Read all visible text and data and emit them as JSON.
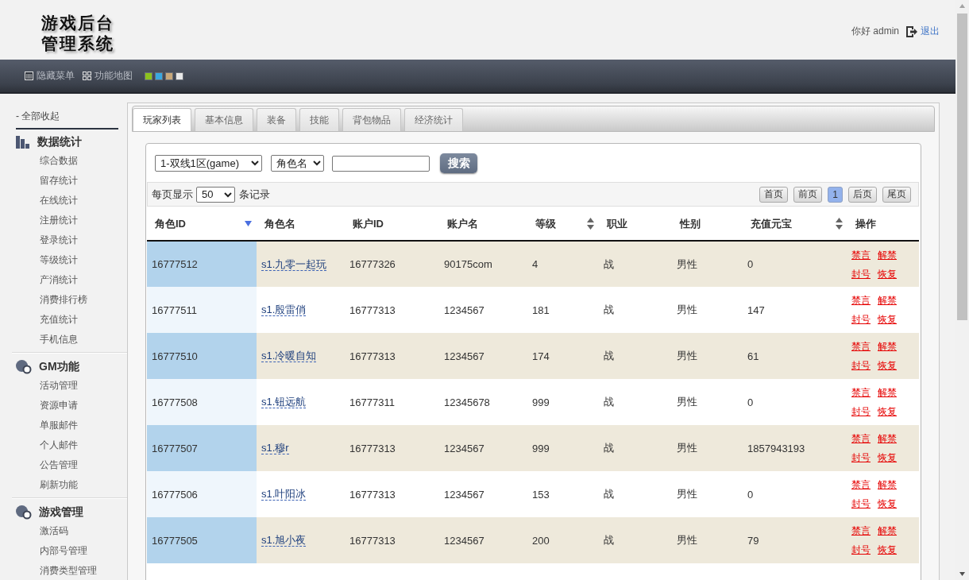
{
  "header": {
    "logo_lines": [
      "游戏后台",
      "管理系统"
    ],
    "greeting": "你好 admin",
    "logout": "退出"
  },
  "nav": {
    "items": [
      {
        "label": "隐藏菜单"
      },
      {
        "label": "功能地图"
      }
    ],
    "themes": [
      {
        "color": "#8cc21e"
      },
      {
        "color": "#3aa8e0"
      },
      {
        "color": "#c8a87a"
      },
      {
        "color": "#e8e8e8"
      }
    ]
  },
  "sidebar": {
    "collapse_all": "- 全部收起",
    "groups": [
      {
        "title": "数据统计",
        "items": [
          "综合数据",
          "留存统计",
          "在线统计",
          "注册统计",
          "登录统计",
          "等级统计",
          "产消统计",
          "消费排行榜",
          "充值统计",
          "手机信息"
        ]
      },
      {
        "title": "GM功能",
        "items": [
          "活动管理",
          "资源申请",
          "单服邮件",
          "个人邮件",
          "公告管理",
          "刷新功能"
        ]
      },
      {
        "title": "游戏管理",
        "items": [
          "激活码",
          "内部号管理",
          "消费类型管理"
        ]
      }
    ]
  },
  "tabs": [
    {
      "label": "玩家列表",
      "selected": true
    },
    {
      "label": "基本信息",
      "selected": false
    },
    {
      "label": "装备",
      "selected": false
    },
    {
      "label": "技能",
      "selected": false
    },
    {
      "label": "背包物品",
      "selected": false
    },
    {
      "label": "经济统计",
      "selected": false
    }
  ],
  "search": {
    "server": "1-双线1区(game)",
    "field": "角色名",
    "button": "搜索"
  },
  "pager": {
    "label_before": "每页显示",
    "page_size": "50",
    "label_after": "条记录",
    "buttons": [
      {
        "label": "首页",
        "selected": false
      },
      {
        "label": "前页",
        "selected": false
      },
      {
        "label": "1",
        "selected": true
      },
      {
        "label": "后页",
        "selected": false
      },
      {
        "label": "尾页",
        "selected": false
      }
    ]
  },
  "table": {
    "columns": [
      {
        "label": "角色ID",
        "kind": "text",
        "sorted": true
      },
      {
        "label": "角色名",
        "kind": "link"
      },
      {
        "label": "账户ID",
        "kind": "text"
      },
      {
        "label": "账户名",
        "kind": "text"
      },
      {
        "label": "等级",
        "kind": "text",
        "sortable": true
      },
      {
        "label": "职业",
        "kind": "text"
      },
      {
        "label": "性别",
        "kind": "text"
      },
      {
        "label": "充值元宝",
        "kind": "text",
        "sortable": true
      },
      {
        "label": "操作",
        "kind": "actions"
      }
    ],
    "rows": [
      {
        "cells": [
          "16777512",
          "s1.九零一起玩",
          "16777326",
          "90175com",
          "4",
          "战",
          "男性",
          "0"
        ],
        "actions": [
          [
            "禁言",
            "解禁"
          ],
          [
            "封号",
            "恢复"
          ]
        ]
      },
      {
        "cells": [
          "16777511",
          "s1.殷雷俏",
          "16777313",
          "1234567",
          "181",
          "战",
          "男性",
          "147"
        ],
        "actions": [
          [
            "禁言",
            "解禁"
          ],
          [
            "封号",
            "恢复"
          ]
        ]
      },
      {
        "cells": [
          "16777510",
          "s1.冷暖自知",
          "16777313",
          "1234567",
          "174",
          "战",
          "男性",
          "61"
        ],
        "actions": [
          [
            "禁言",
            "解禁"
          ],
          [
            "封号",
            "恢复"
          ]
        ]
      },
      {
        "cells": [
          "16777508",
          "s1.钮远航",
          "16777311",
          "12345678",
          "999",
          "战",
          "男性",
          "0"
        ],
        "actions": [
          [
            "禁言",
            "解禁"
          ],
          [
            "封号",
            "恢复"
          ]
        ]
      },
      {
        "cells": [
          "16777507",
          "s1.穆r",
          "16777313",
          "1234567",
          "999",
          "战",
          "男性",
          "1857943193"
        ],
        "actions": [
          [
            "禁言",
            "解禁"
          ],
          [
            "封号",
            "恢复"
          ]
        ]
      },
      {
        "cells": [
          "16777506",
          "s1.叶阳冰",
          "16777313",
          "1234567",
          "153",
          "战",
          "男性",
          "0"
        ],
        "actions": [
          [
            "禁言",
            "解禁"
          ],
          [
            "封号",
            "恢复"
          ]
        ]
      },
      {
        "cells": [
          "16777505",
          "s1.旭小夜",
          "16777313",
          "1234567",
          "200",
          "战",
          "男性",
          "79"
        ],
        "actions": [
          [
            "禁言",
            "解禁"
          ],
          [
            "封号",
            "恢复"
          ]
        ]
      }
    ]
  }
}
